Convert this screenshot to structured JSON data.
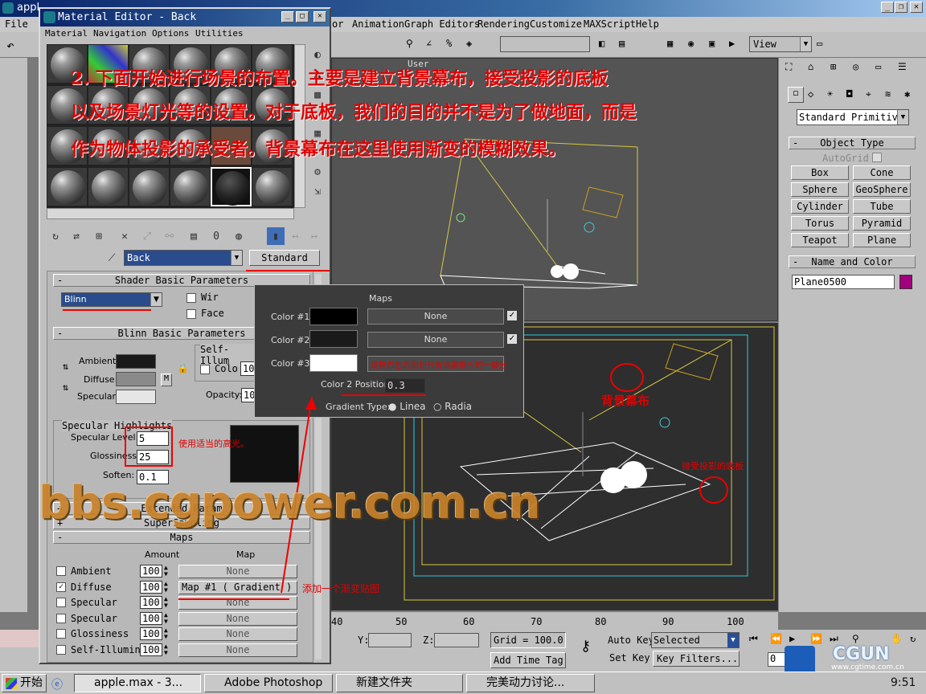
{
  "app": {
    "title": "appl",
    "menus": [
      "File",
      "or",
      "Animation",
      "Graph Editors",
      "Rendering",
      "Customize",
      "MAXScript",
      "Help"
    ],
    "view_dropdown": "View"
  },
  "material_editor": {
    "title": "Material Editor - Back",
    "menus": [
      "Material",
      "Navigation",
      "Options",
      "Utilities"
    ],
    "material_name": "Back",
    "type_button": "Standard",
    "shader_rollout": "Shader Basic Parameters",
    "shader": "Blinn",
    "wire": "Wir",
    "face": "Face",
    "blinn_rollout": "Blinn Basic Parameters",
    "self_illum": "Self-Illum",
    "color_label": "Colo",
    "color_value": "10",
    "ambient": "Ambient:",
    "diffuse": "Diffuse:",
    "specular": "Specular:",
    "m_button": "M",
    "opacity_label": "Opacity:",
    "opacity_value": "10",
    "spec_highlights": "Specular Highlights",
    "spec_level_label": "Specular Level:",
    "spec_level": "5",
    "glossiness_label": "Glossiness:",
    "glossiness": "25",
    "soften_label": "Soften:",
    "soften": "0.1",
    "extended": "Extended Param",
    "supersampling": "SuperSampling",
    "maps_rollout": "Maps",
    "amount_header": "Amount",
    "map_header": "Map",
    "maps": [
      {
        "name": "Ambient",
        "amount": "100",
        "map": "None",
        "checked": false
      },
      {
        "name": "Diffuse",
        "amount": "100",
        "map": "Map #1  ( Gradient )",
        "checked": true
      },
      {
        "name": "Specular",
        "amount": "100",
        "map": "None",
        "checked": false
      },
      {
        "name": "Specular",
        "amount": "100",
        "map": "None",
        "checked": false
      },
      {
        "name": "Glossiness",
        "amount": "100",
        "map": "None",
        "checked": false
      },
      {
        "name": "Self-Illumin",
        "amount": "100",
        "map": "None",
        "checked": false
      }
    ]
  },
  "gradient_panel": {
    "header": "Maps",
    "color1": "Color #1",
    "color2": "Color #2",
    "color3": "Color #3",
    "none1": "None",
    "none2": "None",
    "color2_position_label": "Color 2 Position:",
    "color2_position": "0.3",
    "gradient_type_label": "Gradient Type:",
    "linear": "Linea",
    "radial": "Radia"
  },
  "viewport": {
    "user_label": "User",
    "ruler": [
      "40",
      "50",
      "60",
      "70",
      "80",
      "90",
      "100"
    ]
  },
  "command_panel": {
    "dropdown": "Standard Primitive",
    "object_type": "Object Type",
    "autogrid": "AutoGrid",
    "buttons": [
      "Box",
      "Cone",
      "Sphere",
      "GeoSphere",
      "Cylinder",
      "Tube",
      "Torus",
      "Pyramid",
      "Teapot",
      "Plane"
    ],
    "name_color": "Name and Color",
    "object_name": "Plane0500",
    "object_color": "#a0007c"
  },
  "bottom": {
    "y_label": "Y:",
    "z_label": "Z:",
    "grid": "Grid = 100.0",
    "add_time_tag": "Add Time Tag",
    "auto_key": "Auto Key",
    "selected": "Selected",
    "set_key": "Set Key",
    "key_filters": "Key Filters...",
    "frame": "0"
  },
  "taskbar": {
    "start": "开始",
    "items": [
      "apple.max - 3...",
      "Adobe Photoshop",
      "新建文件夹",
      "完美动力讨论..."
    ],
    "clock": "9:51"
  },
  "annotations": {
    "main_line1": "2. 下面开始进行场景的布置。主要是建立背景幕布，接受投影的底板",
    "main_line2": "以及场景灯光等的设置。对于底板，我们的目的并不是为了做地面，而是",
    "main_line3": "作为物体投影的承受者。背景幕布在这里使用渐变的模糊效果。",
    "white_note": "这样白色的面积只有底部很少的一部分",
    "spec_note": "使用适当的高光。",
    "backdrop": "背景幕布",
    "floor": "接受投影的底板",
    "gradient_map": "添加一个渐变贴图",
    "watermark": "bbs.cgpower.com.cn",
    "logo": "CGUN",
    "logo_url": "www.cgtime.com.cn"
  }
}
